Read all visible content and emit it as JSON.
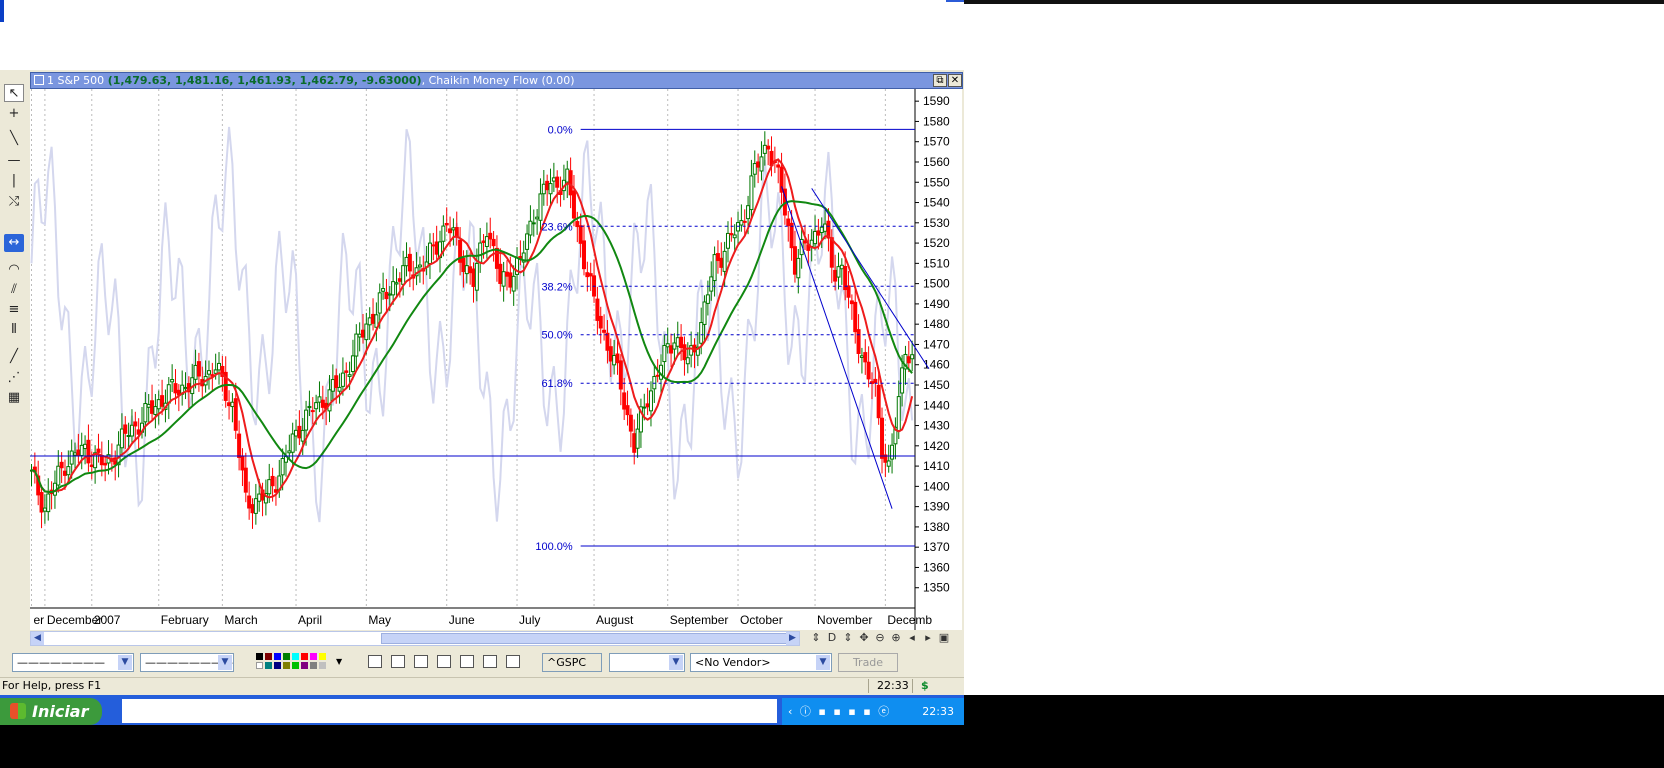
{
  "window": {
    "title_prefix": "1 S&P 500",
    "ohlc": "(1,479.63, 1,481.16, 1,461.93, 1,462.79, -9.63000)",
    "indicator": ", Chaikin Money Flow (0.00)",
    "restore_button": "⧉",
    "close_button": "✕"
  },
  "colors": {
    "price_up": "#007700",
    "price_down": "#ff0000",
    "ma_short": "#ee1c1c",
    "ma_long": "#118811",
    "fib": "#0000cc",
    "cmf": "#d4d7ee"
  },
  "left_toolbar": [
    "pointer-icon",
    "crosshair-icon",
    "trendline-icon",
    "horizontal-line-icon",
    "vertical-line-icon",
    "cycle-icon",
    "scroll-icon",
    "arc-icon",
    "fan-icon",
    "fib-retracement-icon",
    "fib-time-icon",
    "line-icon",
    "gann-icon",
    "grid-icon"
  ],
  "chart_data": {
    "type": "candlestick",
    "title": "1 S&P 500",
    "symbol": "^GSPC",
    "last_ohlc": {
      "open": 1479.63,
      "high": 1481.16,
      "low": 1461.93,
      "close": 1462.79,
      "change": -9.63
    },
    "ylim": [
      1340,
      1596
    ],
    "y_ticks": [
      1350,
      1360,
      1370,
      1380,
      1390,
      1400,
      1410,
      1420,
      1430,
      1440,
      1450,
      1460,
      1470,
      1480,
      1490,
      1500,
      1510,
      1520,
      1530,
      1540,
      1550,
      1560,
      1570,
      1580,
      1590
    ],
    "x_labels": [
      {
        "label": "er",
        "index": 0
      },
      {
        "label": "December",
        "index": 4
      },
      {
        "label": "2007",
        "index": 18
      },
      {
        "label": "February",
        "index": 38
      },
      {
        "label": "March",
        "index": 57
      },
      {
        "label": "April",
        "index": 79
      },
      {
        "label": "May",
        "index": 100
      },
      {
        "label": "June",
        "index": 124
      },
      {
        "label": "July",
        "index": 145
      },
      {
        "label": "August",
        "index": 168
      },
      {
        "label": "September",
        "index": 190
      },
      {
        "label": "October",
        "index": 211
      },
      {
        "label": "November",
        "index": 234
      },
      {
        "label": "Decemb",
        "index": 255
      }
    ],
    "num_bars": 264,
    "close_anchors": [
      [
        0,
        1405
      ],
      [
        4,
        1390
      ],
      [
        10,
        1412
      ],
      [
        16,
        1418
      ],
      [
        22,
        1410
      ],
      [
        28,
        1425
      ],
      [
        34,
        1435
      ],
      [
        40,
        1445
      ],
      [
        46,
        1450
      ],
      [
        55,
        1458
      ],
      [
        60,
        1440
      ],
      [
        64,
        1392
      ],
      [
        70,
        1395
      ],
      [
        75,
        1410
      ],
      [
        80,
        1430
      ],
      [
        85,
        1440
      ],
      [
        92,
        1450
      ],
      [
        100,
        1480
      ],
      [
        110,
        1505
      ],
      [
        118,
        1510
      ],
      [
        124,
        1530
      ],
      [
        128,
        1515
      ],
      [
        132,
        1500
      ],
      [
        136,
        1530
      ],
      [
        140,
        1500
      ],
      [
        146,
        1510
      ],
      [
        150,
        1535
      ],
      [
        155,
        1550
      ],
      [
        160,
        1550
      ],
      [
        164,
        1520
      ],
      [
        168,
        1490
      ],
      [
        172,
        1470
      ],
      [
        176,
        1450
      ],
      [
        180,
        1420
      ],
      [
        184,
        1445
      ],
      [
        188,
        1460
      ],
      [
        192,
        1475
      ],
      [
        196,
        1460
      ],
      [
        200,
        1480
      ],
      [
        204,
        1510
      ],
      [
        208,
        1520
      ],
      [
        212,
        1530
      ],
      [
        216,
        1555
      ],
      [
        220,
        1570
      ],
      [
        224,
        1545
      ],
      [
        228,
        1510
      ],
      [
        232,
        1520
      ],
      [
        236,
        1530
      ],
      [
        240,
        1505
      ],
      [
        242,
        1510
      ],
      [
        244,
        1490
      ],
      [
        248,
        1465
      ],
      [
        252,
        1445
      ],
      [
        254,
        1420
      ],
      [
        256,
        1410
      ],
      [
        259,
        1440
      ],
      [
        261,
        1470
      ],
      [
        263,
        1463
      ]
    ],
    "fib_levels": [
      {
        "label": "0.0%",
        "value": 1576.09,
        "style": "solid"
      },
      {
        "label": "23.6%",
        "value": 1528.28,
        "style": "dashed"
      },
      {
        "label": "38.2%",
        "value": 1498.7,
        "style": "dashed"
      },
      {
        "label": "50.0%",
        "value": 1474.79,
        "style": "dashed"
      },
      {
        "label": "61.8%",
        "value": 1450.88,
        "style": "dashed"
      },
      {
        "label": "100.0%",
        "value": 1370.6,
        "style": "solid"
      }
    ],
    "horizontal_support": 1415,
    "channel_lines": [
      {
        "from": [
          224,
          1548
        ],
        "to": [
          257,
          1389
        ]
      },
      {
        "from": [
          233,
          1547
        ],
        "to": [
          268,
          1458
        ]
      }
    ],
    "moving_averages": [
      "short (red)",
      "long (green)"
    ],
    "indicator": {
      "name": "Chaikin Money Flow",
      "value": 0.0
    }
  },
  "nav": [
    "⇕",
    "D",
    "⇕",
    "✥",
    "⊖",
    "⊕",
    "◂",
    "▸",
    "▣"
  ],
  "toolbar2": {
    "line_style_1": "————————",
    "line_style_2": "————————",
    "symbol": "^GSPC",
    "period": "",
    "vendor": "<No Vendor>",
    "trade_label": "Trade"
  },
  "status": {
    "help_text": "For Help, press F1",
    "time": "22:33",
    "currency_icon": "$"
  },
  "taskbar": {
    "start_label": "Iniciar",
    "clock": "22:33"
  }
}
